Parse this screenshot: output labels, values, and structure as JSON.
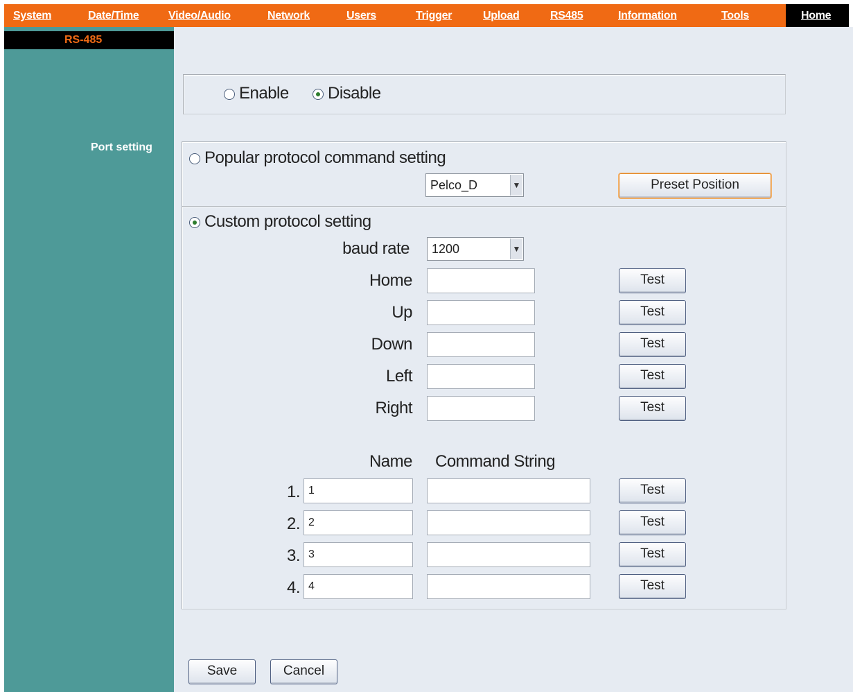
{
  "nav": {
    "items": [
      "System",
      "Date/Time",
      "Video/Audio",
      "Network",
      "Users",
      "Trigger",
      "Upload",
      "RS485",
      "Information",
      "Tools"
    ],
    "home": "Home"
  },
  "sidebar": {
    "title": "RS-485",
    "port_label": "Port setting"
  },
  "rs485": {
    "enable_label": "Enable",
    "disable_label": "Disable",
    "selected": "Disable"
  },
  "popular": {
    "label": "Popular protocol command setting",
    "selected": false,
    "protocol": "Pelco_D",
    "preset_button": "Preset Position"
  },
  "custom": {
    "label": "Custom protocol setting",
    "selected": true,
    "baud_label": "baud rate",
    "baud_value": "1200",
    "commands": [
      {
        "label": "Home",
        "value": "",
        "button": "Test"
      },
      {
        "label": "Up",
        "value": "",
        "button": "Test"
      },
      {
        "label": "Down",
        "value": "",
        "button": "Test"
      },
      {
        "label": "Left",
        "value": "",
        "button": "Test"
      },
      {
        "label": "Right",
        "value": "",
        "button": "Test"
      }
    ],
    "name_header": "Name",
    "command_header": "Command String",
    "custom_rows": [
      {
        "index": "1.",
        "name": "1",
        "command": "",
        "button": "Test"
      },
      {
        "index": "2.",
        "name": "2",
        "command": "",
        "button": "Test"
      },
      {
        "index": "3.",
        "name": "3",
        "command": "",
        "button": "Test"
      },
      {
        "index": "4.",
        "name": "4",
        "command": "",
        "button": "Test"
      }
    ]
  },
  "footer": {
    "save": "Save",
    "cancel": "Cancel"
  },
  "colors": {
    "nav": "#f06a14",
    "sidebar": "#4e9a98",
    "main_bg": "#e6ebf2"
  }
}
